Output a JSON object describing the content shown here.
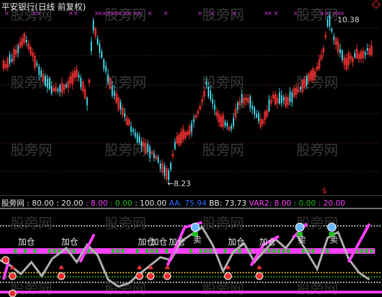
{
  "price_pane": {
    "title": "平安银行(日线 前复权)",
    "high_label": "10.38",
    "low_label": "←8.23",
    "watermark": "股旁网",
    "colors": {
      "up": "#e83030",
      "down": "#3ed0e0",
      "marker": "#cc33cc",
      "grid": "#8a2a2a"
    }
  },
  "indicator_pane": {
    "header": {
      "name": "股旁网",
      "v1": ": 80.00",
      "v2": ": 20.00",
      "v3": ": 8.00",
      "v4": ": 0.00",
      "v5": ": 100.00",
      "aa": "AA: 75.94",
      "bb": "BB: 73.73",
      "var2": "VAR2: 8.00",
      "var2b": ": 0.00",
      "var2c": ": 20.00"
    },
    "buy_label": "加仓",
    "sell_label": "卖",
    "watermark": "股旁网",
    "colors": {
      "magenta": "#ff40ff",
      "grey": "#b0b0b0",
      "green": "#20c020",
      "yellow": "#e8d820",
      "blue": "#2f6cff"
    }
  }
}
